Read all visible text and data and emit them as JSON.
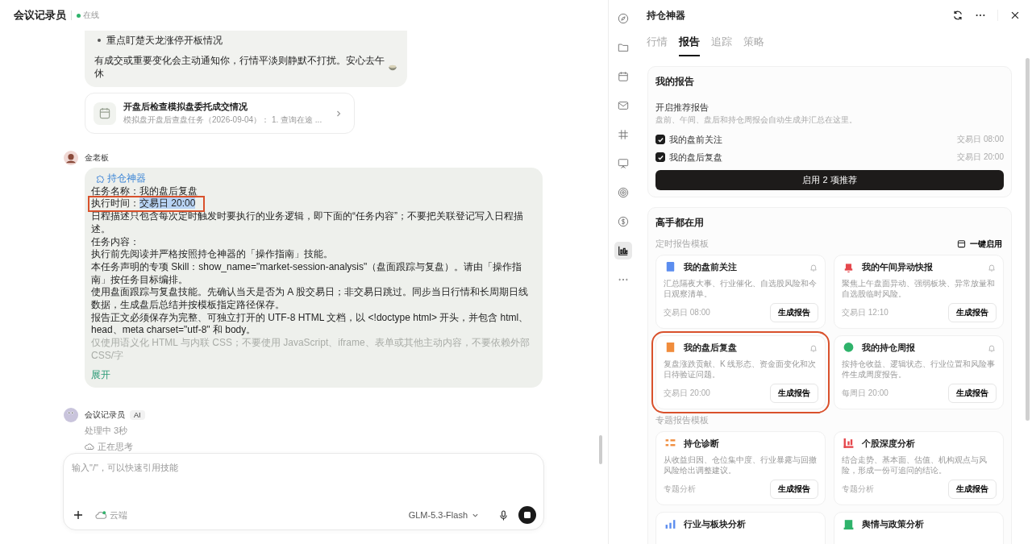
{
  "chat": {
    "title": "会议记录员",
    "status": "在线",
    "online": true,
    "prev_message": {
      "bullets": [
        "重点盯楚天龙涨停开板情况"
      ],
      "text": "有成交或重要变化会主动通知你，行情平淡则静默不打扰。安心去午休"
    },
    "task_card": {
      "title": "开盘后检查模拟盘委托成交情况",
      "subtitle": "模拟盘开盘后查盘任务（2026-09-04）： 1. 查询在途 ..."
    },
    "user_message": {
      "sender": "金老板",
      "skill": "持仓神器",
      "lines": [
        {
          "kind": "text",
          "text": "任务名称：我的盘后复盘"
        },
        {
          "kind": "field",
          "label": "执行时间：",
          "value": "交易日 20:00",
          "value_selected": true,
          "annotated": true
        },
        {
          "kind": "text",
          "text": "日程描述只包含每次定时触发时要执行的业务逻辑，即下面的“任务内容”；不要把关联登记写入日程描述。"
        },
        {
          "kind": "text",
          "text": "任务内容："
        },
        {
          "kind": "text",
          "text": "执行前先阅读并严格按照持仓神器的「操作指南」技能。"
        },
        {
          "kind": "text",
          "text": "本任务声明的专项 Skill：show_name=\"market-session-analysis\"（盘面跟踪与复盘）。请由「操作指南」按任务目标编排。"
        },
        {
          "kind": "text",
          "text": "使用盘面跟踪与复盘技能。先确认当天是否为 A 股交易日；非交易日跳过。同步当日行情和长周期日线数据，生成盘后总结并按模板指定路径保存。"
        },
        {
          "kind": "text",
          "text": "报告正文必须保存为完整、可独立打开的 UTF-8 HTML 文档，以 <!doctype html> 开头，并包含 html、head、meta charset=\"utf-8\" 和 body。"
        },
        {
          "kind": "faded",
          "text": "仅使用语义化 HTML 与内联 CSS；不要使用 JavaScript、iframe、表单或其他主动内容，不要依赖外部 CSS/字"
        }
      ],
      "expand": "展开"
    },
    "ai_message": {
      "sender": "会议记录员",
      "badge": "AI",
      "status": "处理中 3秒",
      "thinking": "正在思考"
    },
    "composer": {
      "placeholder": "输入\"/\"，可以快速引用技能",
      "cloud": "云端",
      "model": "GLM-5.3-Flash"
    }
  },
  "panel": {
    "rail": [
      {
        "selected": false
      },
      {
        "selected": false
      },
      {
        "selected": false
      },
      {
        "selected": false
      },
      {
        "selected": false
      },
      {
        "selected": false
      },
      {
        "selected": false
      },
      {
        "selected": false
      },
      {
        "selected": true
      },
      {
        "selected": false
      }
    ],
    "title": "持仓神器",
    "tabs": [
      {
        "label": "行情",
        "selected": false
      },
      {
        "label": "报告",
        "selected": true
      },
      {
        "label": "追踪",
        "selected": false
      },
      {
        "label": "策略",
        "selected": false
      }
    ],
    "my_reports": {
      "title": "我的报告",
      "subtitle": "开启推荐报告",
      "hint": "盘前、午间、盘后和持仓周报会自动生成并汇总在这里。",
      "items": [
        {
          "label": "我的盘前关注",
          "time": "交易日 08:00",
          "checked": true
        },
        {
          "label": "我的盘后复盘",
          "time": "交易日 20:00",
          "checked": true
        }
      ],
      "button": "启用 2 项推荐"
    },
    "popular": {
      "title": "高手都在用",
      "sections": [
        {
          "title": "定时报告模板",
          "action": "一键启用",
          "cards": [
            {
              "color": "#5b8def",
              "title": "我的盘前关注",
              "desc": "汇总隔夜大事、行业催化、自选股风险和今日观察清单。",
              "meta": "交易日 08:00",
              "button": "生成报告",
              "bell": true,
              "annotated": false
            },
            {
              "color": "#e5484d",
              "title": "我的午间异动快报",
              "desc": "聚焦上午盘面异动、强弱板块、异常放量和自选股临时风险。",
              "meta": "交易日 12:10",
              "button": "生成报告",
              "bell": true,
              "annotated": false
            },
            {
              "color": "#f08c3c",
              "title": "我的盘后复盘",
              "desc": "复盘涨跌贡献、K 线形态、资金面变化和次日待验证问题。",
              "meta": "交易日 20:00",
              "button": "生成报告",
              "bell": true,
              "annotated": true
            },
            {
              "color": "#2fb36b",
              "title": "我的持仓周报",
              "desc": "按持仓收益、逻辑状态、行业位置和风险事件生成周度报告。",
              "meta": "每周日 20:00",
              "button": "生成报告",
              "bell": true,
              "annotated": false
            }
          ]
        },
        {
          "title": "专题报告模板",
          "cards": [
            {
              "color": "#f08c3c",
              "title": "持仓诊断",
              "desc": "从收益归因、仓位集中度、行业暴露与回撤风险给出调整建议。",
              "meta": "专题分析",
              "button": "生成报告",
              "annotated": false
            },
            {
              "color": "#e5484d",
              "title": "个股深度分析",
              "desc": "结合走势、基本面、估值、机构观点与风险，形成一份可追问的结论。",
              "meta": "专题分析",
              "button": "生成报告",
              "annotated": false
            },
            {
              "color": "#5b8def",
              "title": "行业与板块分析",
              "annotated": false
            },
            {
              "color": "#2fb36b",
              "title": "舆情与政策分析",
              "annotated": false
            }
          ]
        }
      ]
    }
  }
}
